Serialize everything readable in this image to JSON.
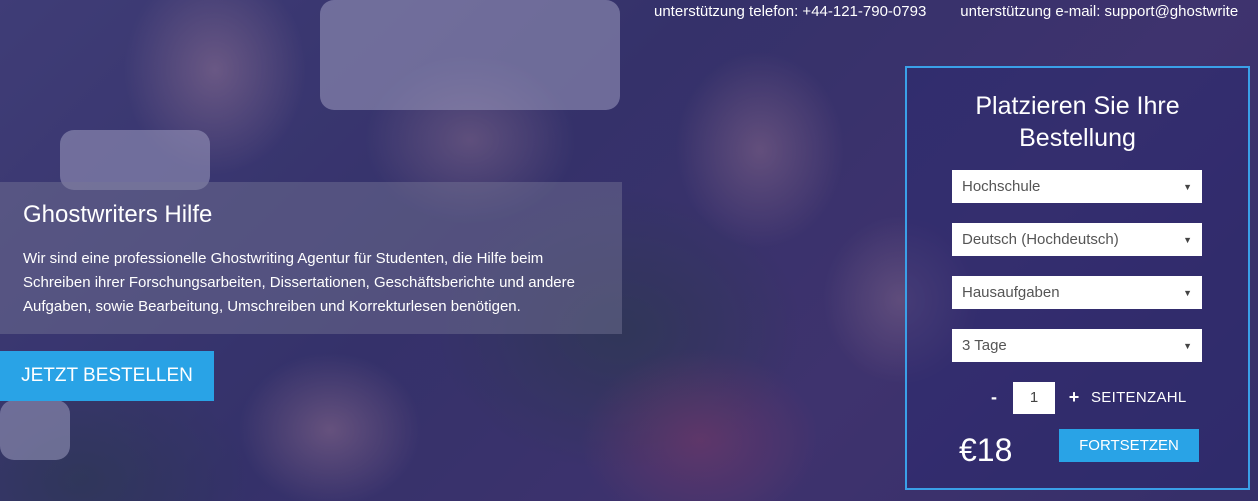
{
  "topbar": {
    "phone": "unterstützung telefon: +44-121-790-0793",
    "email": "unterstützung e-mail: support@ghostwrite"
  },
  "hero": {
    "title": "Ghostwriters Hilfe",
    "text": "Wir sind eine professionelle Ghostwriting Agentur für Studenten, die Hilfe beim Schreiben ihrer Forschungsarbeiten, Dissertationen, Geschäftsberichte und andere Aufgaben, sowie Bearbeitung, Umschreiben und Korrekturlesen benötigen.",
    "cta_label": "JETZT BESTELLEN"
  },
  "order_form": {
    "title": "Platzieren Sie Ihre Bestellung",
    "academic_level": "Hochschule",
    "language": "Deutsch (Hochdeutsch)",
    "paper_type": "Hausaufgaben",
    "deadline": "3 Tage",
    "pages": "1",
    "minus": "-",
    "plus": "+",
    "pages_label": "SEITENZAHL",
    "price": "€18",
    "continue_label": "FORTSETZEN"
  },
  "colors": {
    "accent": "#29a3e6",
    "panel_border": "#3aa0e8"
  }
}
